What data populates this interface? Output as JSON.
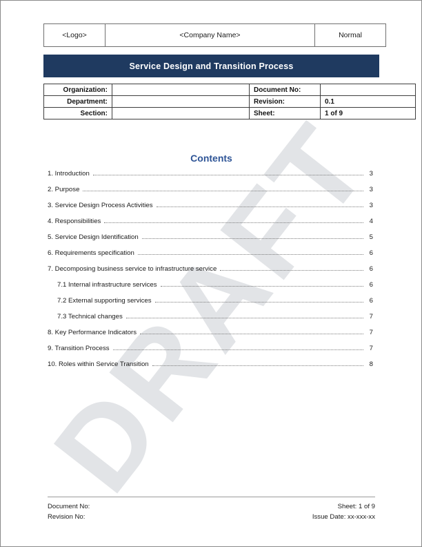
{
  "header": {
    "logo": "<Logo>",
    "company": "<Company Name>",
    "status": "Normal"
  },
  "title_bar": {
    "title": "Service Design and Transition Process",
    "background": "#1f3a60",
    "text_color": "#ffffff"
  },
  "info_table": {
    "rows": [
      {
        "label_left": "Organization:",
        "value_left": "",
        "label_right": "Document No:",
        "value_right": ""
      },
      {
        "label_left": "Department:",
        "value_left": "",
        "label_right": "Revision:",
        "value_right": "0.1"
      },
      {
        "label_left": "Section:",
        "value_left": "",
        "label_right": "Sheet:",
        "value_right": "1 of 9"
      }
    ]
  },
  "contents": {
    "heading": "Contents",
    "heading_color": "#2e5496",
    "entries": [
      {
        "label": "1. Introduction",
        "page": "3",
        "level": 1
      },
      {
        "label": "2. Purpose",
        "page": "3",
        "level": 1
      },
      {
        "label": "3. Service Design Process Activities",
        "page": "3",
        "level": 1
      },
      {
        "label": "4. Responsibilities",
        "page": "4",
        "level": 1
      },
      {
        "label": "5. Service Design Identification",
        "page": "5",
        "level": 1
      },
      {
        "label": "6. Requirements specification",
        "page": "6",
        "level": 1
      },
      {
        "label": "7. Decomposing business service to infrastructure service",
        "page": "6",
        "level": 1
      },
      {
        "label": "7.1 Internal infrastructure services",
        "page": "6",
        "level": 2
      },
      {
        "label": "7.2 External supporting services",
        "page": "6",
        "level": 2
      },
      {
        "label": "7.3 Technical changes",
        "page": "7",
        "level": 2
      },
      {
        "label": "8. Key Performance Indicators",
        "page": "7",
        "level": 1
      },
      {
        "label": "9. Transition Process",
        "page": "7",
        "level": 1
      },
      {
        "label": "10. Roles within Service Transition",
        "page": "8",
        "level": 1
      }
    ]
  },
  "watermark": {
    "text": "DRAFT",
    "color": "#e2e4e7"
  },
  "footer": {
    "document_no": "Document No:",
    "revision_no": "Revision No:",
    "sheet": "Sheet: 1 of 9",
    "issue_date": "Issue Date: xx-xxx-xx"
  }
}
